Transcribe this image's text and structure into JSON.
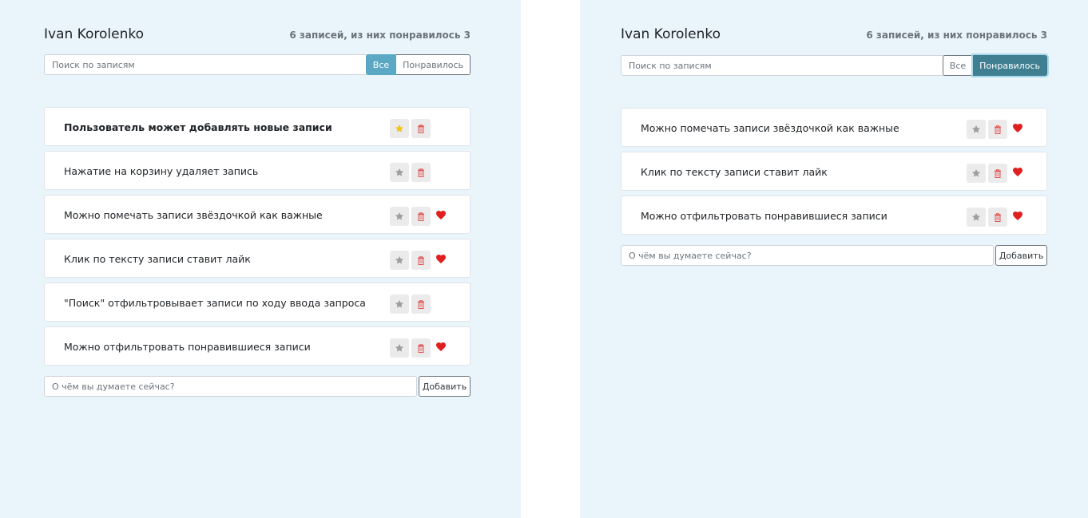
{
  "colors": {
    "panel_bg": "#eaf4fb",
    "star_active": "#f0c419",
    "star_inactive": "#9e9e9e",
    "trash": "#e05555",
    "heart": "#e02020",
    "active_filter_left": "#5aa8c4",
    "active_filter_right": "#3f7f91"
  },
  "left": {
    "user_name": "Ivan Korolenko",
    "stats": "6 записей, из них понравилось 3",
    "search_placeholder": "Поиск по записям",
    "filters": [
      "Все",
      "Понравилось"
    ],
    "active_filter": "Все",
    "items": [
      {
        "text": "Пользователь может добавлять новые записи",
        "important": true,
        "liked": false
      },
      {
        "text": "Нажатие на корзину удаляет запись",
        "important": false,
        "liked": false
      },
      {
        "text": "Можно помечать записи звёздочкой как важные",
        "important": false,
        "liked": true
      },
      {
        "text": "Клик по тексту записи ставит лайк",
        "important": false,
        "liked": true
      },
      {
        "text": "\"Поиск\" отфильтровывает записи по ходу ввода запроса",
        "important": false,
        "liked": false
      },
      {
        "text": "Можно отфильтровать понравившиеся записи",
        "important": false,
        "liked": true
      }
    ],
    "add_placeholder": "О чём вы думаете сейчас?",
    "add_label": "Добавить"
  },
  "right": {
    "user_name": "Ivan Korolenko",
    "stats": "6 записей, из них понравилось 3",
    "search_placeholder": "Поиск по записям",
    "filters": [
      "Все",
      "Понравилось"
    ],
    "active_filter": "Понравилось",
    "items": [
      {
        "text": "Можно помечать записи звёздочкой как важные",
        "important": false,
        "liked": true
      },
      {
        "text": "Клик по тексту записи ставит лайк",
        "important": false,
        "liked": true
      },
      {
        "text": "Можно отфильтровать понравившиеся записи",
        "important": false,
        "liked": true
      }
    ],
    "add_placeholder": "О чём вы думаете сейчас?",
    "add_label": "Добавить"
  }
}
